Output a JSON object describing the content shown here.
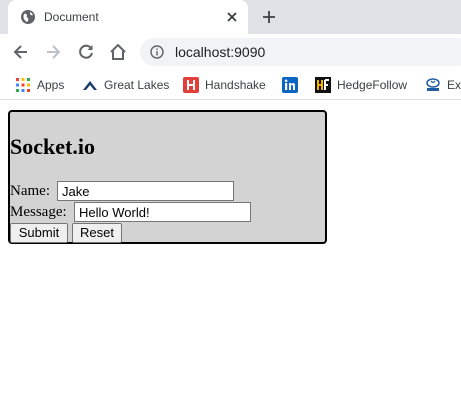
{
  "browser": {
    "tab": {
      "title": "Document",
      "favicon": "globe-icon"
    },
    "toolbar": {
      "url": "localhost:9090"
    },
    "bookmarks": [
      {
        "label": "Apps",
        "icon": "apps-grid-icon"
      },
      {
        "label": "Great Lakes",
        "icon": "great-lakes-icon"
      },
      {
        "label": "Handshake",
        "icon": "handshake-icon"
      },
      {
        "label": "",
        "icon": "linkedin-icon"
      },
      {
        "label": "HedgeFollow",
        "icon": "hedgefollow-icon"
      },
      {
        "label": "Ex",
        "icon": "tata-icon"
      }
    ]
  },
  "page": {
    "title": "Socket.io",
    "form": {
      "name_label": "Name:",
      "name_value": "Jake",
      "message_label": "Message:",
      "message_value": "Hello World!",
      "submit_label": "Submit",
      "reset_label": "Reset"
    }
  },
  "colors": {
    "panel_background": "#d3d3d3",
    "panel_border": "#000000",
    "tabstrip": "#dee1e6",
    "omnibox": "#f1f3f4"
  }
}
